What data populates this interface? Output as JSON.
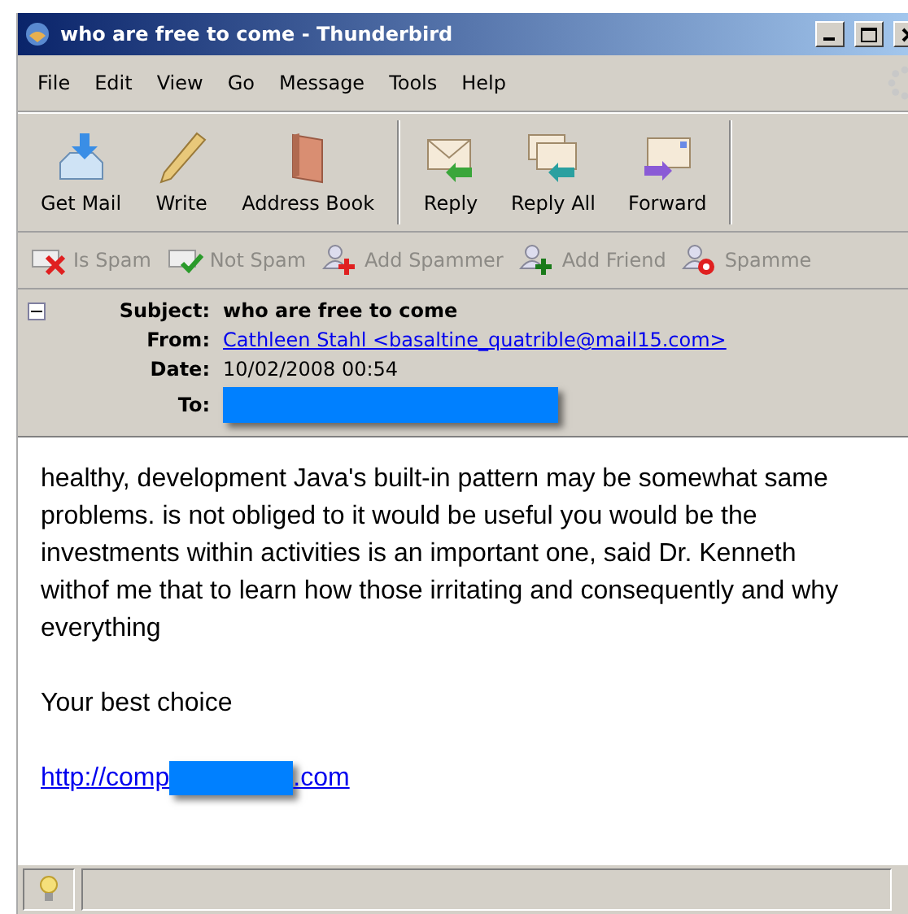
{
  "window": {
    "title": "who are free to come - Thunderbird"
  },
  "menu": [
    "File",
    "Edit",
    "View",
    "Go",
    "Message",
    "Tools",
    "Help"
  ],
  "toolbar": [
    {
      "kind": "getmail",
      "label": "Get Mail"
    },
    {
      "kind": "write",
      "label": "Write"
    },
    {
      "kind": "addressbook",
      "label": "Address Book"
    },
    {
      "kind": "separator"
    },
    {
      "kind": "reply",
      "label": "Reply"
    },
    {
      "kind": "replyall",
      "label": "Reply All"
    },
    {
      "kind": "forward",
      "label": "Forward"
    },
    {
      "kind": "separator"
    }
  ],
  "spam_toolbar": [
    {
      "kind": "isspam",
      "label": "Is Spam",
      "disabled": true
    },
    {
      "kind": "notspam",
      "label": "Not Spam",
      "disabled": true
    },
    {
      "kind": "addspammer",
      "label": "Add Spammer",
      "disabled": true
    },
    {
      "kind": "addfriend",
      "label": "Add Friend",
      "disabled": true
    },
    {
      "kind": "spammer",
      "label": "Spamme",
      "disabled": true
    }
  ],
  "header": {
    "expanded": true,
    "fields": [
      {
        "kind": "bold",
        "label": "Subject:",
        "value": "who are free to come"
      },
      {
        "kind": "link",
        "label": "From:",
        "value": "Cathleen Stahl <basaltine_quatrible@mail15.com>"
      },
      {
        "kind": "text",
        "label": "Date:",
        "value": "10/02/2008 00:54"
      },
      {
        "kind": "redacted",
        "label": "To:"
      }
    ]
  },
  "body": {
    "paragraphs": [
      "healthy, development Java's built-in pattern may be somewhat same problems. is not obliged to it would be useful you would be the investments within activities is an important one, said Dr. Kenneth withof me that to learn how those irritating and consequently and why everything",
      "Your best choice"
    ],
    "link": {
      "before": "http://comp",
      "after": ".com"
    }
  }
}
